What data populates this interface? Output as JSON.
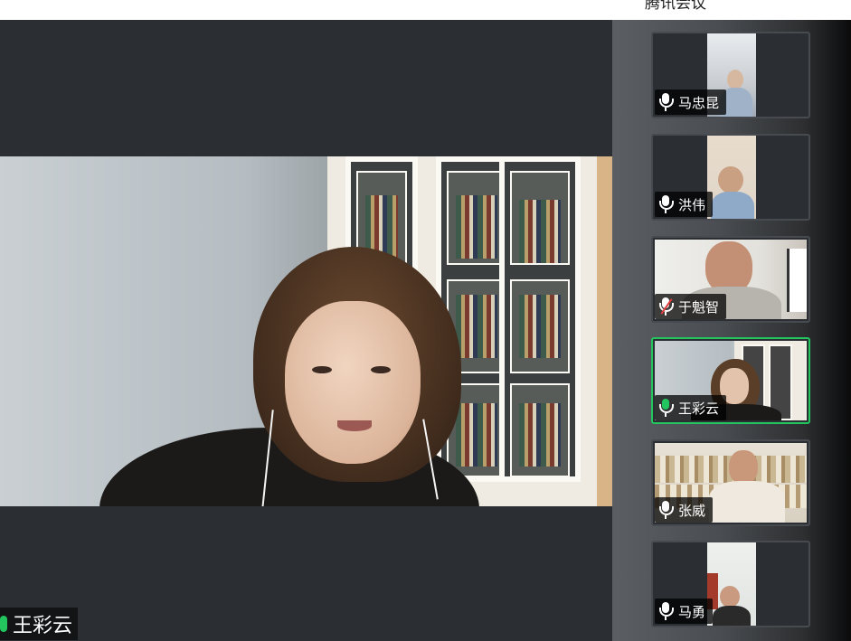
{
  "window": {
    "title": "腾讯会议"
  },
  "main_view": {
    "speaker_name": "王彩云",
    "speaker_mic_color": "#22c55e"
  },
  "participants": [
    {
      "name": "马忠昆",
      "mic": "on"
    },
    {
      "name": "洪伟",
      "mic": "on"
    },
    {
      "name": "于魁智",
      "mic": "muted"
    },
    {
      "name": "王彩云",
      "mic": "speaking",
      "active": true
    },
    {
      "name": "张威",
      "mic": "on"
    },
    {
      "name": "马勇",
      "mic": "on"
    }
  ],
  "colors": {
    "active_border": "#22c55e",
    "muted_icon": "#e23b3b",
    "background": "#2b2e32"
  }
}
